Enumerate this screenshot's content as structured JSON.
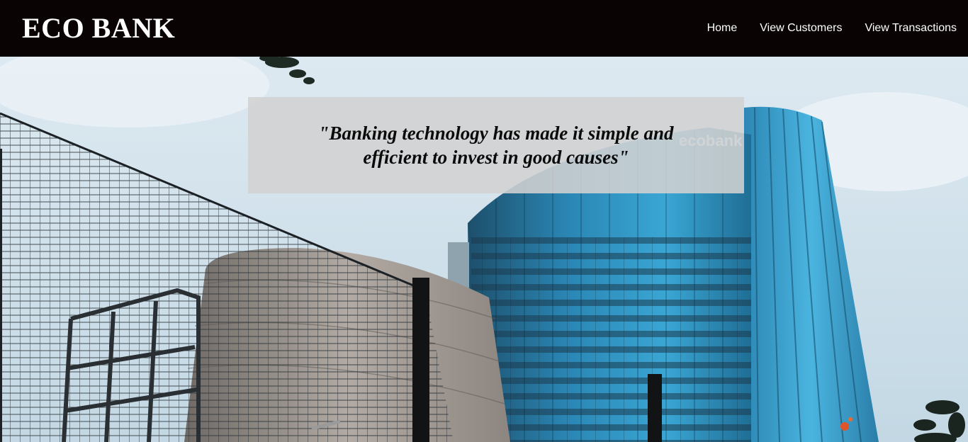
{
  "navbar": {
    "brand": "ECO BANK",
    "links": [
      {
        "label": "Home"
      },
      {
        "label": "View Customers"
      },
      {
        "label": "View Transactions"
      }
    ]
  },
  "hero": {
    "quote": "\"Banking technology has made it simple and efficient to invest in good causes\"",
    "building_sign": "ecobank"
  },
  "colors": {
    "navbar_bg": "#090304",
    "nav_text": "#ffffff",
    "quote_box_bg": "#d2d2d2",
    "quote_text": "#0a0a0a",
    "glass_blue": "#2f8fbf"
  }
}
